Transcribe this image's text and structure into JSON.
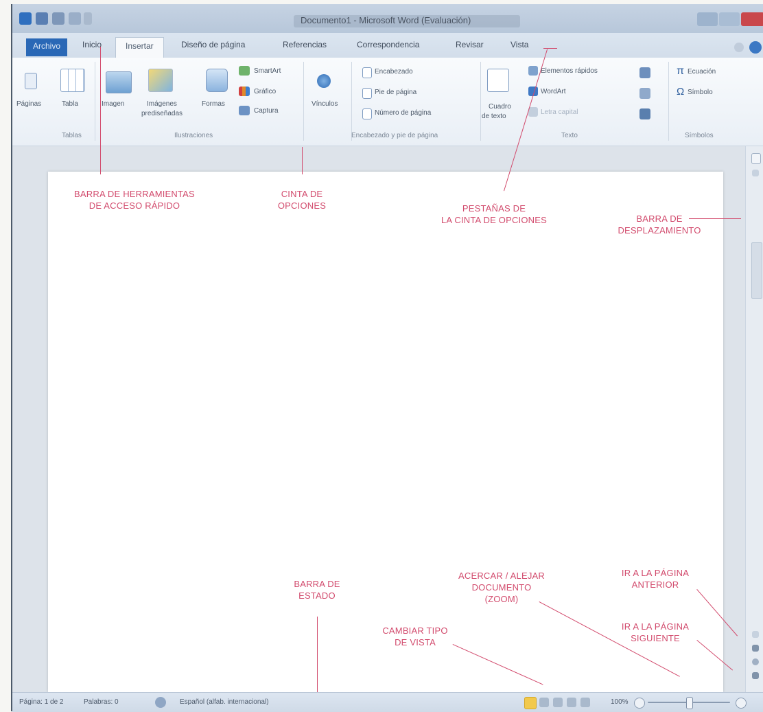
{
  "window": {
    "title": "Documento1 - Microsoft Word (Evaluación)"
  },
  "tabs": [
    {
      "label": "Archivo"
    },
    {
      "label": "Inicio"
    },
    {
      "label": "Insertar"
    },
    {
      "label": "Diseño de página"
    },
    {
      "label": "Referencias"
    },
    {
      "label": "Correspondencia"
    },
    {
      "label": "Revisar"
    },
    {
      "label": "Vista"
    }
  ],
  "ribbon": {
    "paginas": "Páginas",
    "tabla": "Tabla",
    "imagen": "Imagen",
    "imagenes_line1": "Imágenes",
    "imagenes_line2": "prediseñadas",
    "formas": "Formas",
    "smartart": "SmartArt",
    "grafico": "Gráfico",
    "captura": "Captura",
    "vinculos": "Vínculos",
    "encabezado": "Encabezado",
    "pie_pagina": "Pie de página",
    "numero_pagina": "Número de página",
    "cuadro_line1": "Cuadro",
    "cuadro_line2": "de texto",
    "elementos_rapidos": "Elementos rápidos",
    "wordart": "WordArt",
    "letra_capital": "Letra capital",
    "ecuacion": "Ecuación",
    "simbolo": "Símbolo",
    "groups": {
      "tablas": "Tablas",
      "ilustraciones": "Ilustraciones",
      "encabezado_pie": "Encabezado y pie de página",
      "texto": "Texto",
      "simbolos": "Símbolos"
    }
  },
  "status": {
    "pagina": "Página: 1 de 2",
    "palabras": "Palabras: 0",
    "idioma": "Español (alfab. internacional)",
    "zoom": "100%"
  },
  "annotations": {
    "qat": "BARRA DE HERRAMIENTAS\nDE ACCESO RÁPIDO",
    "cinta": "CINTA DE\nOPCIONES",
    "pestanas": "PESTAÑAS DE\nLA CINTA DE OPCIONES",
    "desplaz": "BARRA DE\nDESPLAZAMIENTO",
    "estado": "BARRA DE\nESTADO",
    "zoom": "ACERCAR / ALEJAR\nDOCUMENTO\n(ZOOM)",
    "pag_anterior": "IR A LA PÁGINA\nANTERIOR",
    "pag_siguiente": "IR A LA PÁGINA\nSIGUIENTE",
    "vista": "CAMBIAR TIPO\nDE VISTA"
  },
  "colors": {
    "annotation": "#d24b6d",
    "file_tab": "#2a68b6",
    "close_button": "#c9474b"
  }
}
